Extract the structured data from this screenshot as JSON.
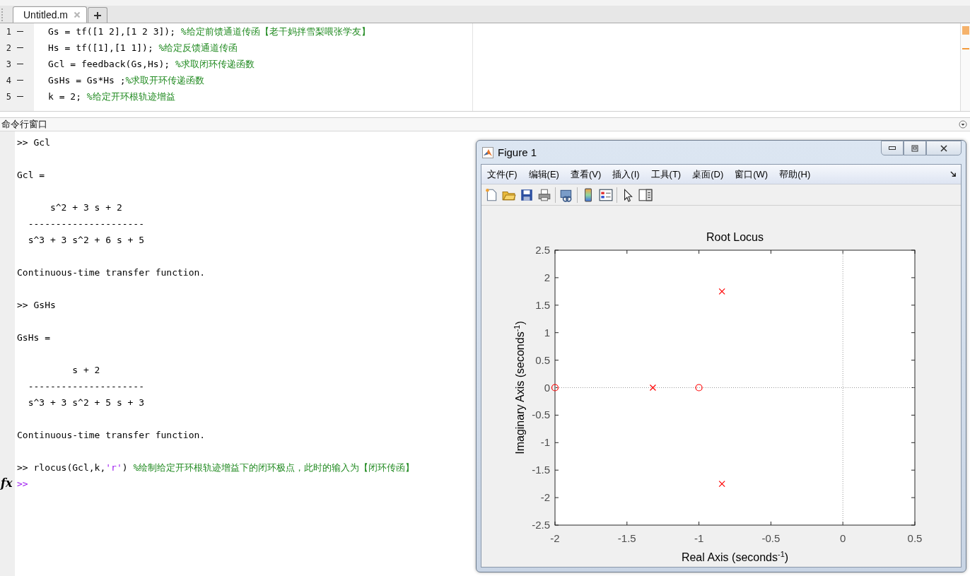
{
  "editor": {
    "tabs": [
      {
        "label": "Untitled.m",
        "selected": true
      }
    ],
    "lines": [
      {
        "number": "1",
        "segments": [
          {
            "kind": "code",
            "text": "Gs = tf([1 2],[1 2 3]); "
          },
          {
            "kind": "comment",
            "text": "%给定前馈通道传函【老干妈拌雪梨喂张学友】"
          }
        ]
      },
      {
        "number": "2",
        "segments": [
          {
            "kind": "code",
            "text": "Hs = tf([1],[1 1]); "
          },
          {
            "kind": "comment",
            "text": "%给定反馈通道传函"
          }
        ]
      },
      {
        "number": "3",
        "segments": [
          {
            "kind": "code",
            "text": "Gcl = feedback(Gs,Hs); "
          },
          {
            "kind": "comment",
            "text": "%求取闭环传递函数"
          }
        ]
      },
      {
        "number": "4",
        "segments": [
          {
            "kind": "code",
            "text": "GsHs = Gs*Hs ;"
          },
          {
            "kind": "comment",
            "text": "%求取开环传递函数"
          }
        ]
      },
      {
        "number": "5",
        "segments": [
          {
            "kind": "code",
            "text": "k = 2; "
          },
          {
            "kind": "comment",
            "text": "%给定开环根轨迹增益"
          }
        ]
      }
    ]
  },
  "command_window": {
    "title": "命令行窗口",
    "fx": "fx",
    "lines": [
      {
        "kind": "input",
        "segments": [
          {
            "kind": "code",
            "text": ">> Gcl"
          }
        ]
      },
      {
        "kind": "blank"
      },
      {
        "kind": "output",
        "text": "Gcl ="
      },
      {
        "kind": "blank"
      },
      {
        "kind": "output",
        "text": "      s^2 + 3 s + 2"
      },
      {
        "kind": "output",
        "text": "  ---------------------"
      },
      {
        "kind": "output",
        "text": "  s^3 + 3 s^2 + 6 s + 5"
      },
      {
        "kind": "blank"
      },
      {
        "kind": "output",
        "text": "Continuous-time transfer function."
      },
      {
        "kind": "blank"
      },
      {
        "kind": "input",
        "segments": [
          {
            "kind": "code",
            "text": ">> GsHs"
          }
        ]
      },
      {
        "kind": "blank"
      },
      {
        "kind": "output",
        "text": "GsHs ="
      },
      {
        "kind": "blank"
      },
      {
        "kind": "output",
        "text": "          s + 2"
      },
      {
        "kind": "output",
        "text": "  ---------------------"
      },
      {
        "kind": "output",
        "text": "  s^3 + 3 s^2 + 5 s + 3"
      },
      {
        "kind": "blank"
      },
      {
        "kind": "output",
        "text": "Continuous-time transfer function."
      },
      {
        "kind": "blank"
      },
      {
        "kind": "input",
        "segments": [
          {
            "kind": "code",
            "text": ">> rlocus(Gcl,k,"
          },
          {
            "kind": "string",
            "text": "'r'"
          },
          {
            "kind": "code",
            "text": ") "
          },
          {
            "kind": "comment",
            "text": "%绘制给定开环根轨迹增益下的闭环极点，此时的输入为【闭环传函】"
          }
        ]
      },
      {
        "kind": "cursor",
        "text": ">>"
      }
    ]
  },
  "figure": {
    "title": "Figure 1",
    "menu": [
      "文件(F)",
      "编辑(E)",
      "查看(V)",
      "插入(I)",
      "工具(T)",
      "桌面(D)",
      "窗口(W)",
      "帮助(H)"
    ],
    "chart_data": {
      "type": "scatter",
      "title": "Root Locus",
      "xlabel": "Real Axis (seconds$^{-1}$)",
      "ylabel": "Imaginary Axis (seconds$^{-1}$)",
      "xlim": [
        -2,
        0.5
      ],
      "ylim": [
        -2.5,
        2.5
      ],
      "xticks": [
        -2,
        -1.5,
        -1,
        -0.5,
        0,
        0.5
      ],
      "yticks": [
        -2.5,
        -2,
        -1.5,
        -1,
        -0.5,
        0,
        0.5,
        1,
        1.5,
        2,
        2.5
      ],
      "series": [
        {
          "color": "#ff0000",
          "marker": "x",
          "x": [
            -0.84,
            -1.32,
            -0.84
          ],
          "values": [
            1.75,
            0,
            -1.75
          ]
        },
        {
          "color": "#ff0000",
          "marker": "o",
          "x": [
            -2,
            -1
          ],
          "values": [
            0,
            0
          ]
        }
      ]
    }
  }
}
